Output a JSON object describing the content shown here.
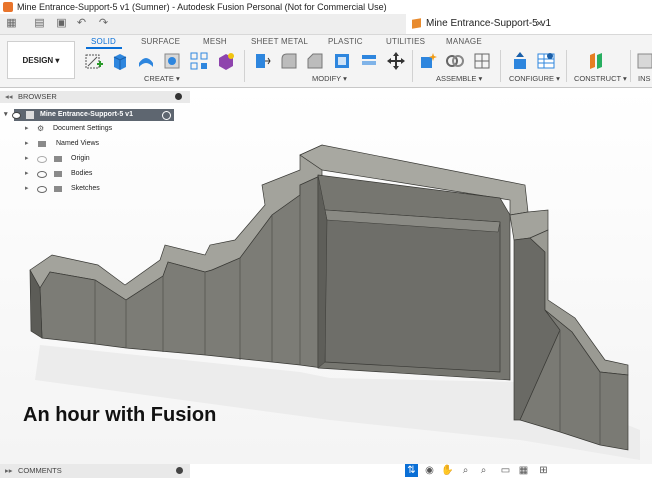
{
  "window": {
    "title": "Mine Entrance-Support-5 v1 (Sumner) - Autodesk Fusion Personal (Not for Commercial Use)"
  },
  "document_tab": {
    "name": "Mine Entrance-Support-5 v1",
    "close": "×"
  },
  "workspace_button": {
    "label": "DESIGN ▾"
  },
  "ribbon": {
    "tabs": [
      "SOLID",
      "SURFACE",
      "MESH",
      "SHEET METAL",
      "PLASTIC",
      "UTILITIES",
      "MANAGE"
    ],
    "active_tab": "SOLID",
    "groups": [
      "CREATE ▾",
      "MODIFY ▾",
      "ASSEMBLE ▾",
      "CONFIGURE ▾",
      "CONSTRUCT ▾",
      "INS"
    ]
  },
  "browser": {
    "header": "BROWSER",
    "root": "Mine Entrance-Support-5 v1",
    "items": [
      {
        "label": "Document Settings"
      },
      {
        "label": "Named Views"
      },
      {
        "label": "Origin"
      },
      {
        "label": "Bodies"
      },
      {
        "label": "Sketches"
      }
    ]
  },
  "comments": {
    "label": "COMMENTS"
  },
  "caption": {
    "text": "An hour with Fusion"
  },
  "colors": {
    "accent": "#0a6fd6",
    "model": "#7a7a74",
    "model_dark": "#4e4e4a"
  }
}
